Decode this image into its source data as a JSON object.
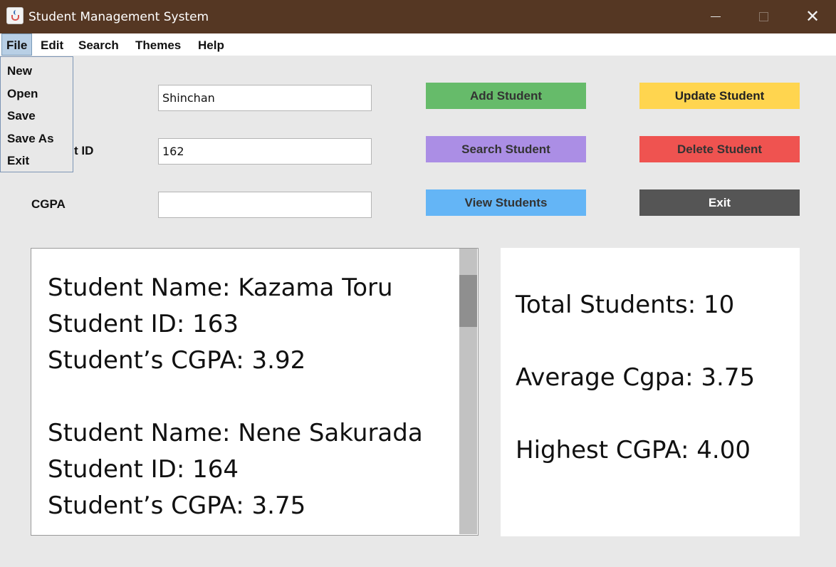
{
  "window": {
    "title": "Student Management System",
    "icon": "java-cup-icon",
    "controls": {
      "minimize": "minimize-icon",
      "maximize": "maximize-icon",
      "close": "✕"
    }
  },
  "menubar": {
    "items": [
      "File",
      "Edit",
      "Search",
      "Themes",
      "Help"
    ]
  },
  "file_menu": {
    "items": [
      "New",
      "Open",
      "Save",
      "Save As",
      "Exit"
    ]
  },
  "form": {
    "id_label_visible": "t ID",
    "cgpa_label": "CGPA",
    "name_value": "Shinchan",
    "id_value": "162",
    "cgpa_value": ""
  },
  "buttons": {
    "add": "Add Student",
    "update": "Update Student",
    "search": "Search Student",
    "delete": "Delete Student",
    "view": "View Students",
    "exit": "Exit"
  },
  "records": [
    {
      "name": "Student Name: Kazama Toru",
      "id": "Student ID: 163",
      "cgpa": "Student’s CGPA: 3.92"
    },
    {
      "name": "Student Name: Nene Sakurada",
      "id": "Student ID: 164",
      "cgpa": "Student’s CGPA: 3.75"
    }
  ],
  "stats": {
    "total": "Total Students: 10",
    "average": "Average Cgpa: 3.75",
    "highest": "Highest CGPA: 4.00"
  },
  "colors": {
    "titlebar": "#553723",
    "add": "#66bb6a",
    "update": "#ffd54f",
    "search": "#ab8ee5",
    "delete": "#ef5350",
    "view": "#64b5f6",
    "exit": "#555555"
  }
}
